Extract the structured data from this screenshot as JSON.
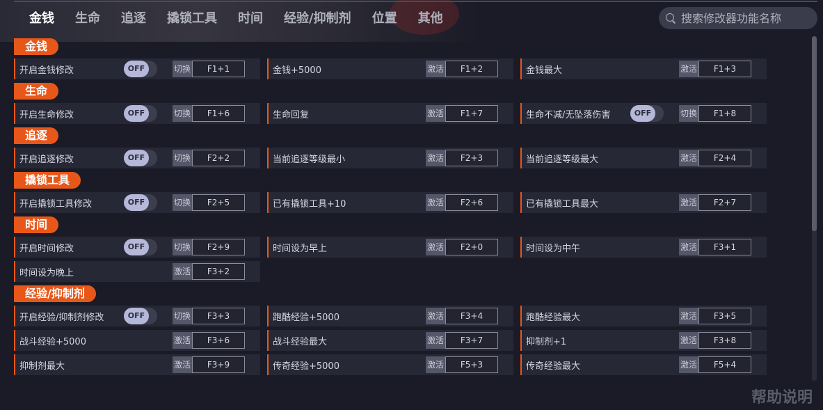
{
  "nav": {
    "tabs": [
      "金钱",
      "生命",
      "追逐",
      "撬锁工具",
      "时间",
      "经验/抑制剂",
      "位置",
      "其他"
    ],
    "active": 0
  },
  "search": {
    "placeholder": "搜索修改器功能名称"
  },
  "toggle_off_label": "OFF",
  "sections": [
    {
      "title": "金钱",
      "rows": [
        [
          {
            "label": "开启金钱修改",
            "toggle": true,
            "hk": "切换",
            "key": "F1+1"
          },
          {
            "label": "金钱+5000",
            "toggle": false,
            "hk": "激活",
            "key": "F1+2"
          },
          {
            "label": "金钱最大",
            "toggle": false,
            "hk": "激活",
            "key": "F1+3"
          }
        ]
      ]
    },
    {
      "title": "生命",
      "rows": [
        [
          {
            "label": "开启生命修改",
            "toggle": true,
            "hk": "切换",
            "key": "F1+6"
          },
          {
            "label": "生命回复",
            "toggle": false,
            "hk": "激活",
            "key": "F1+7"
          },
          {
            "label": "生命不减/无坠落伤害",
            "toggle": true,
            "hk": "切换",
            "key": "F1+8"
          }
        ]
      ]
    },
    {
      "title": "追逐",
      "rows": [
        [
          {
            "label": "开启追逐修改",
            "toggle": true,
            "hk": "切换",
            "key": "F2+2"
          },
          {
            "label": "当前追逐等级最小",
            "toggle": false,
            "hk": "激活",
            "key": "F2+3"
          },
          {
            "label": "当前追逐等级最大",
            "toggle": false,
            "hk": "激活",
            "key": "F2+4"
          }
        ]
      ]
    },
    {
      "title": "撬锁工具",
      "rows": [
        [
          {
            "label": "开启撬锁工具修改",
            "toggle": true,
            "hk": "切换",
            "key": "F2+5"
          },
          {
            "label": "已有撬锁工具+10",
            "toggle": false,
            "hk": "激活",
            "key": "F2+6"
          },
          {
            "label": "已有撬锁工具最大",
            "toggle": false,
            "hk": "激活",
            "key": "F2+7"
          }
        ]
      ]
    },
    {
      "title": "时间",
      "rows": [
        [
          {
            "label": "开启时间修改",
            "toggle": true,
            "hk": "切换",
            "key": "F2+9"
          },
          {
            "label": "时间设为早上",
            "toggle": false,
            "hk": "激活",
            "key": "F2+0"
          },
          {
            "label": "时间设为中午",
            "toggle": false,
            "hk": "激活",
            "key": "F3+1"
          }
        ],
        [
          {
            "label": "时间设为晚上",
            "toggle": false,
            "hk": "激活",
            "key": "F3+2"
          }
        ]
      ]
    },
    {
      "title": "经验/抑制剂",
      "rows": [
        [
          {
            "label": "开启经验/抑制剂修改",
            "toggle": true,
            "hk": "切换",
            "key": "F3+3"
          },
          {
            "label": "跑酷经验+5000",
            "toggle": false,
            "hk": "激活",
            "key": "F3+4"
          },
          {
            "label": "跑酷经验最大",
            "toggle": false,
            "hk": "激活",
            "key": "F3+5"
          }
        ],
        [
          {
            "label": "战斗经验+5000",
            "toggle": false,
            "hk": "激活",
            "key": "F3+6"
          },
          {
            "label": "战斗经验最大",
            "toggle": false,
            "hk": "激活",
            "key": "F3+7"
          },
          {
            "label": "抑制剂+1",
            "toggle": false,
            "hk": "激活",
            "key": "F3+8"
          }
        ],
        [
          {
            "label": "抑制剂最大",
            "toggle": false,
            "hk": "激活",
            "key": "F3+9"
          },
          {
            "label": "传奇经验+5000",
            "toggle": false,
            "hk": "激活",
            "key": "F5+3"
          },
          {
            "label": "传奇经验最大",
            "toggle": false,
            "hk": "激活",
            "key": "F5+4"
          }
        ]
      ]
    }
  ],
  "help_label": "帮助说明",
  "colors": {
    "accent": "#e8571a",
    "background": "#1a1b26",
    "row": "#272836"
  }
}
